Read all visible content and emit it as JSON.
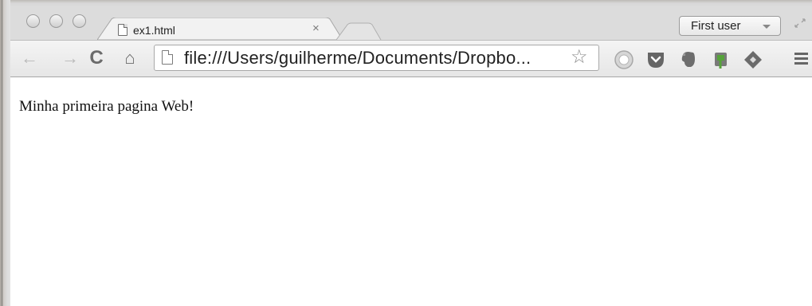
{
  "window": {
    "controls": [
      "close",
      "minimize",
      "zoom"
    ]
  },
  "tabs": [
    {
      "title": "ex1.html",
      "close_glyph": "×",
      "icon": "page-icon",
      "active": true
    }
  ],
  "profile": {
    "label": "First user",
    "icon": "caret-down-icon"
  },
  "toolbar": {
    "back_glyph": "←",
    "forward_glyph": "→",
    "reload_glyph": "C",
    "home_glyph": "⌂",
    "url": "file:///Users/guilherme/Documents/Dropbo...",
    "star_glyph": "☆",
    "extensions": [
      "adblock-icon",
      "pocket-icon",
      "evernote-icon",
      "clip-icon",
      "feedly-icon"
    ],
    "menu_icon": "hamburger-menu-icon"
  },
  "page": {
    "text": "Minha primeira pagina Web!"
  },
  "colors": {
    "chrome_bg": "#dcdcdc",
    "toolbar_bg": "#ececec",
    "content_bg": "#ffffff"
  }
}
